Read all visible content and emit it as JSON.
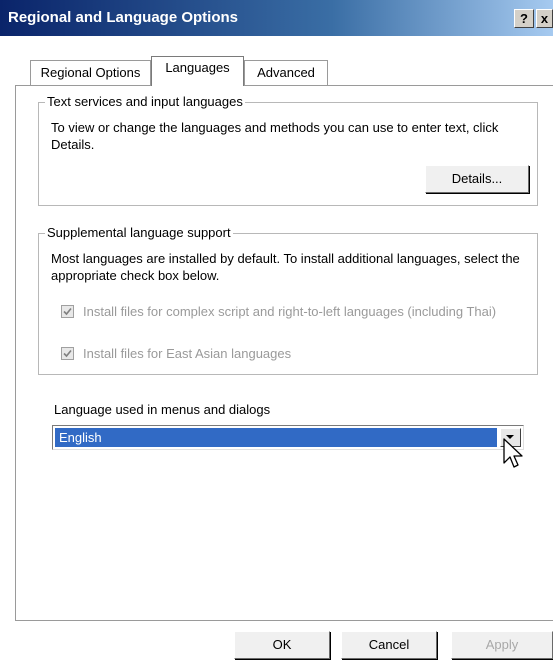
{
  "window": {
    "title": "Regional and Language Options",
    "help_label": "?",
    "close_label": "x"
  },
  "tabs": [
    {
      "label": "Regional Options",
      "selected": false
    },
    {
      "label": "Languages",
      "selected": true
    },
    {
      "label": "Advanced",
      "selected": false
    }
  ],
  "text_services": {
    "legend": "Text services and input languages",
    "description": "To view or change the languages and methods you can use to enter text, click Details.",
    "details_label": "Details..."
  },
  "supplemental": {
    "legend": "Supplemental language support",
    "description": "Most languages are installed by default. To install additional languages, select the appropriate check box below.",
    "checkboxes": [
      {
        "label": "Install files for complex script and right-to-left languages (including Thai)",
        "checked": true,
        "enabled": false
      },
      {
        "label": "Install files for East Asian languages",
        "checked": true,
        "enabled": false
      }
    ]
  },
  "ui_language": {
    "label": "Language used in menus and dialogs",
    "selected": "English"
  },
  "buttons": {
    "ok": "OK",
    "cancel": "Cancel",
    "apply": "Apply"
  },
  "colors": {
    "title_gradient_start": "#0a246a",
    "title_gradient_end": "#a6caf0",
    "selection": "#316ac5",
    "disabled_text": "#9a9a9a"
  },
  "icons": {
    "checkmark": "check-icon",
    "dropdown": "chevron-down-icon",
    "cursor": "mouse-pointer-icon"
  }
}
